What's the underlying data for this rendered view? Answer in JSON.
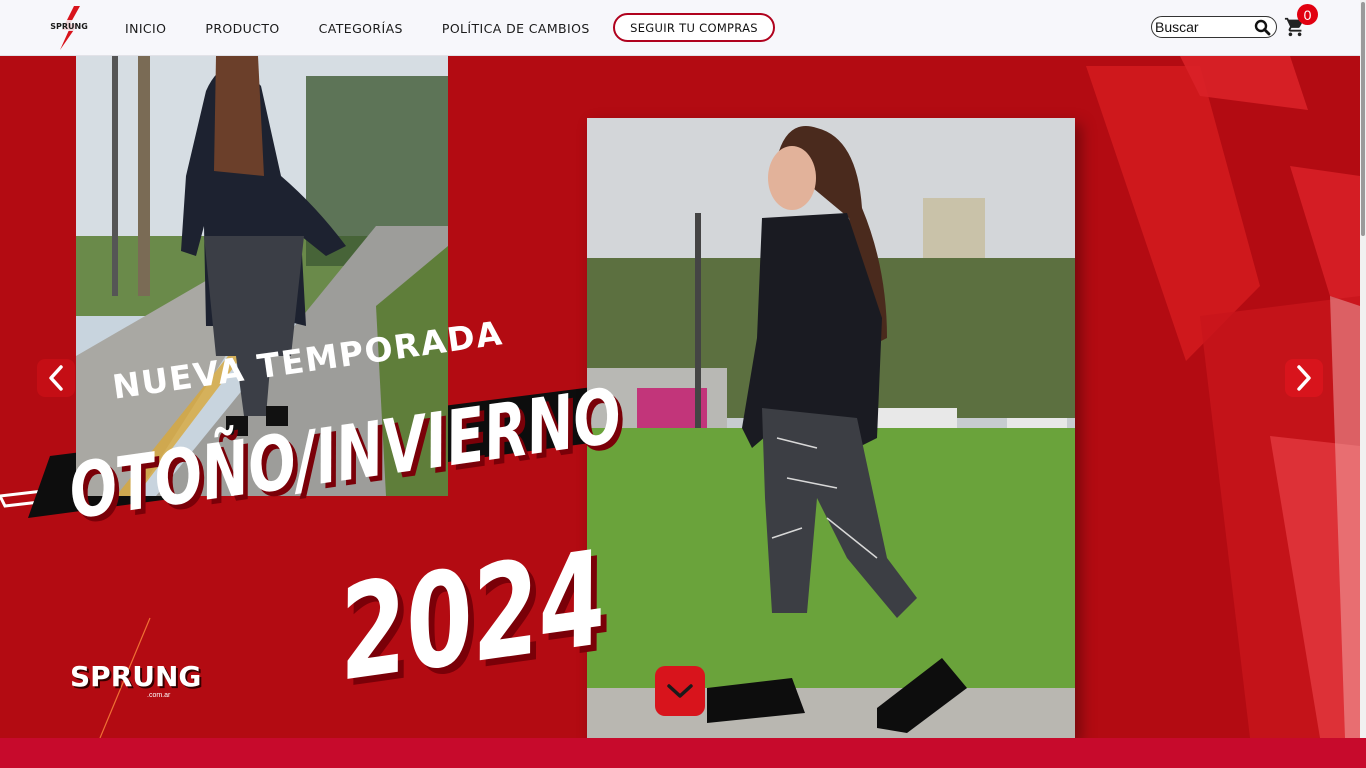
{
  "navbar": {
    "logo_text": "SPRUNG",
    "links": [
      {
        "label": "INICIO"
      },
      {
        "label": "PRODUCTO"
      },
      {
        "label": "CATEGORÍAS"
      },
      {
        "label": "POLÍTICA DE CAMBIOS"
      }
    ],
    "track_order_label": "SEGUIR TU COMPRAS",
    "search": {
      "placeholder": "Buscar",
      "value": ""
    },
    "cart": {
      "count": "0"
    }
  },
  "hero": {
    "headline_1": "NUEVA TEMPORADA",
    "headline_2": "OTOÑO/INVIERNO",
    "headline_3": "2024",
    "brand": "SPRUNG",
    "brand_sub": ".com.ar"
  },
  "colors": {
    "brand_red": "#b30b12",
    "accent_red": "#d8141c",
    "band_red": "#c70a2c"
  },
  "icons": {
    "search": "search-icon",
    "cart": "cart-icon",
    "prev": "chevron-left-icon",
    "next": "chevron-right-icon",
    "down": "chevron-down-icon"
  }
}
